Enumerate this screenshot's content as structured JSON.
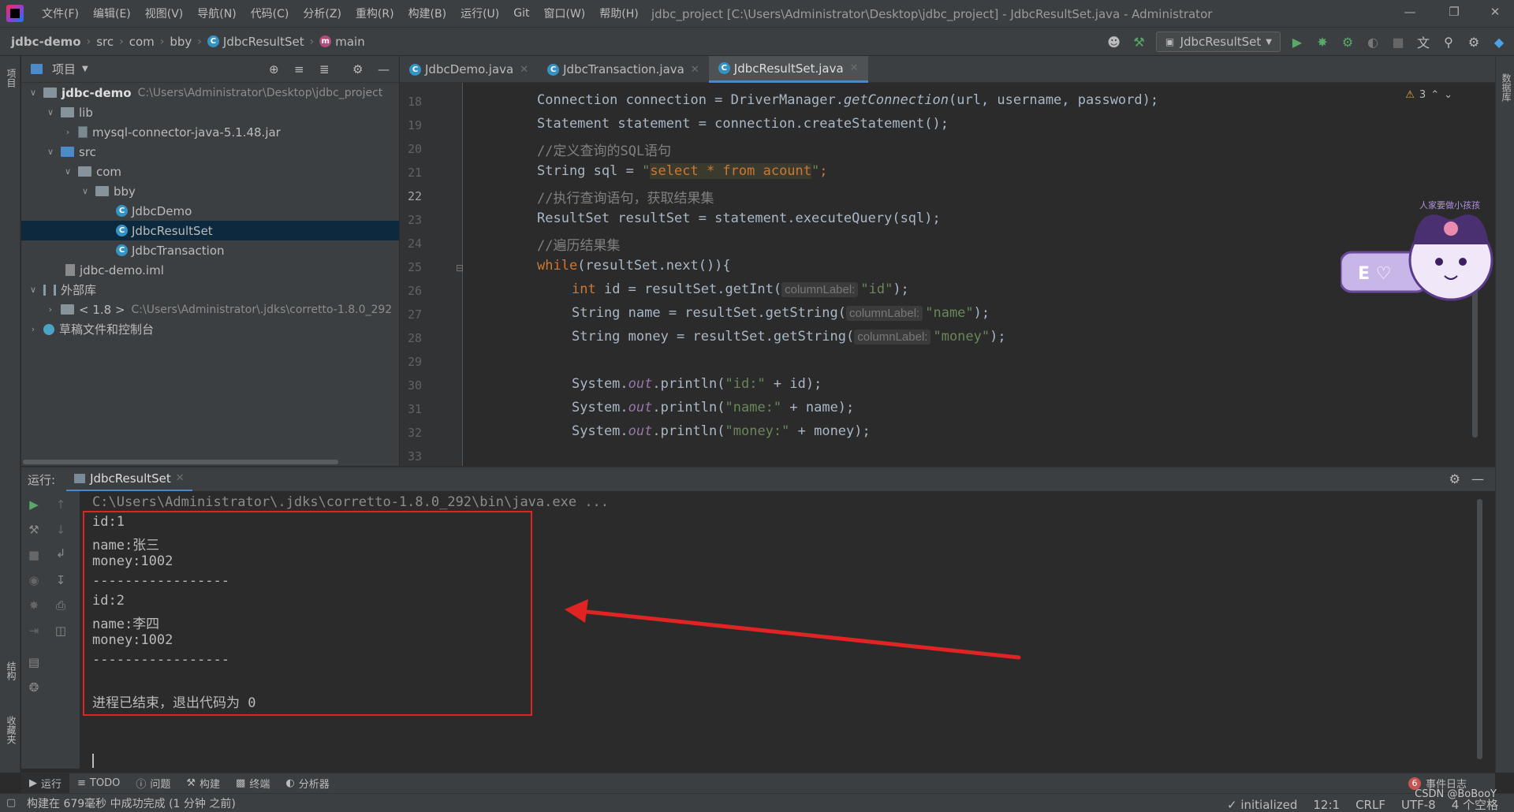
{
  "menubar": {
    "items": [
      "文件(F)",
      "编辑(E)",
      "视图(V)",
      "导航(N)",
      "代码(C)",
      "分析(Z)",
      "重构(R)",
      "构建(B)",
      "运行(U)",
      "Git",
      "窗口(W)",
      "帮助(H)"
    ],
    "window_title": "jdbc_project [C:\\Users\\Administrator\\Desktop\\jdbc_project] - JdbcResultSet.java - Administrator"
  },
  "navbar": {
    "crumbs": [
      "jdbc-demo",
      "src",
      "com",
      "bby",
      "JdbcResultSet",
      "main"
    ],
    "run_config": "JdbcResultSet"
  },
  "project": {
    "title": "项目",
    "tree": [
      {
        "label": "jdbc-demo",
        "path": "C:\\Users\\Administrator\\Desktop\\jdbc_project"
      },
      {
        "label": "lib"
      },
      {
        "label": "mysql-connector-java-5.1.48.jar"
      },
      {
        "label": "src"
      },
      {
        "label": "com"
      },
      {
        "label": "bby"
      },
      {
        "label": "JdbcDemo"
      },
      {
        "label": "JdbcResultSet"
      },
      {
        "label": "JdbcTransaction"
      },
      {
        "label": "jdbc-demo.iml"
      },
      {
        "label": "外部库"
      },
      {
        "label": "< 1.8 >",
        "path": "C:\\Users\\Administrator\\.jdks\\corretto-1.8.0_292"
      },
      {
        "label": "草稿文件和控制台"
      }
    ]
  },
  "left_stripe": {
    "tabs": [
      "项目",
      "结构",
      "收藏夹"
    ]
  },
  "right_stripe": {
    "tabs": [
      "数据库"
    ]
  },
  "editor": {
    "tabs": [
      "JdbcDemo.java",
      "JdbcTransaction.java",
      "JdbcResultSet.java"
    ],
    "active_tab": "JdbcResultSet.java",
    "warnings": "3",
    "line_numbers": [
      "18",
      "19",
      "20",
      "21",
      "22",
      "23",
      "24",
      "25",
      "26",
      "27",
      "28",
      "29",
      "30",
      "31",
      "32",
      "33"
    ],
    "current_line": "22",
    "code": {
      "l18": [
        "Connection connection = DriverManager.",
        "getConnection",
        "(url, username, password);"
      ],
      "l19": "Statement statement = connection.createStatement();",
      "l20": "//定义查询的SQL语句",
      "l21": [
        "String sql = ",
        "\"",
        "select * from acount",
        "\"",
        ";"
      ],
      "l22": "//执行查询语句，获取结果集",
      "l23": "ResultSet resultSet = statement.executeQuery(sql);",
      "l24": "//遍历结果集",
      "l25": [
        "while",
        "(resultSet.next()){"
      ],
      "l26": [
        "int",
        " id = resultSet.getInt(",
        "columnLabel:",
        "\"id\"",
        ");"
      ],
      "l27": [
        "String name = resultSet.getString(",
        "columnLabel:",
        "\"name\"",
        ");"
      ],
      "l28": [
        "String money = resultSet.getString(",
        "columnLabel:",
        "\"money\"",
        ");"
      ],
      "l30": [
        "System.",
        "out",
        ".println(",
        "\"id:\"",
        " + id);"
      ],
      "l31": [
        "System.",
        "out",
        ".println(",
        "\"name:\"",
        " + name);"
      ],
      "l32": [
        "System.",
        "out",
        ".println(",
        "\"money:\"",
        " + money);"
      ]
    }
  },
  "run_panel": {
    "label": "运行:",
    "tab": "JdbcResultSet",
    "command": "C:\\Users\\Administrator\\.jdks\\corretto-1.8.0_292\\bin\\java.exe ...",
    "output": [
      "id:1",
      "name:张三",
      "money:1002",
      "-----------------",
      "id:2",
      "name:李四",
      "money:1002",
      "-----------------"
    ],
    "exit_message": "进程已结束，退出代码为 0"
  },
  "bottom_tools": [
    "运行",
    "TODO",
    "问题",
    "构建",
    "终端",
    "分析器"
  ],
  "event_log": {
    "count": "6",
    "label": "事件日志"
  },
  "statusbar": {
    "message": "构建在 679毫秒 中成功完成 (1 分钟 之前)",
    "initialized": "initialized",
    "position": "12:1",
    "line_sep": "CRLF",
    "encoding": "UTF-8",
    "indent": "4 个空格",
    "watermark": "CSDN @BoBooY"
  },
  "sticker_text": "人家要做小孩孩",
  "colors": {
    "accent": "#4a88c7",
    "keyword": "#cc7832",
    "string": "#6a8759",
    "comment": "#808080",
    "annotation_red": "#e02424"
  }
}
